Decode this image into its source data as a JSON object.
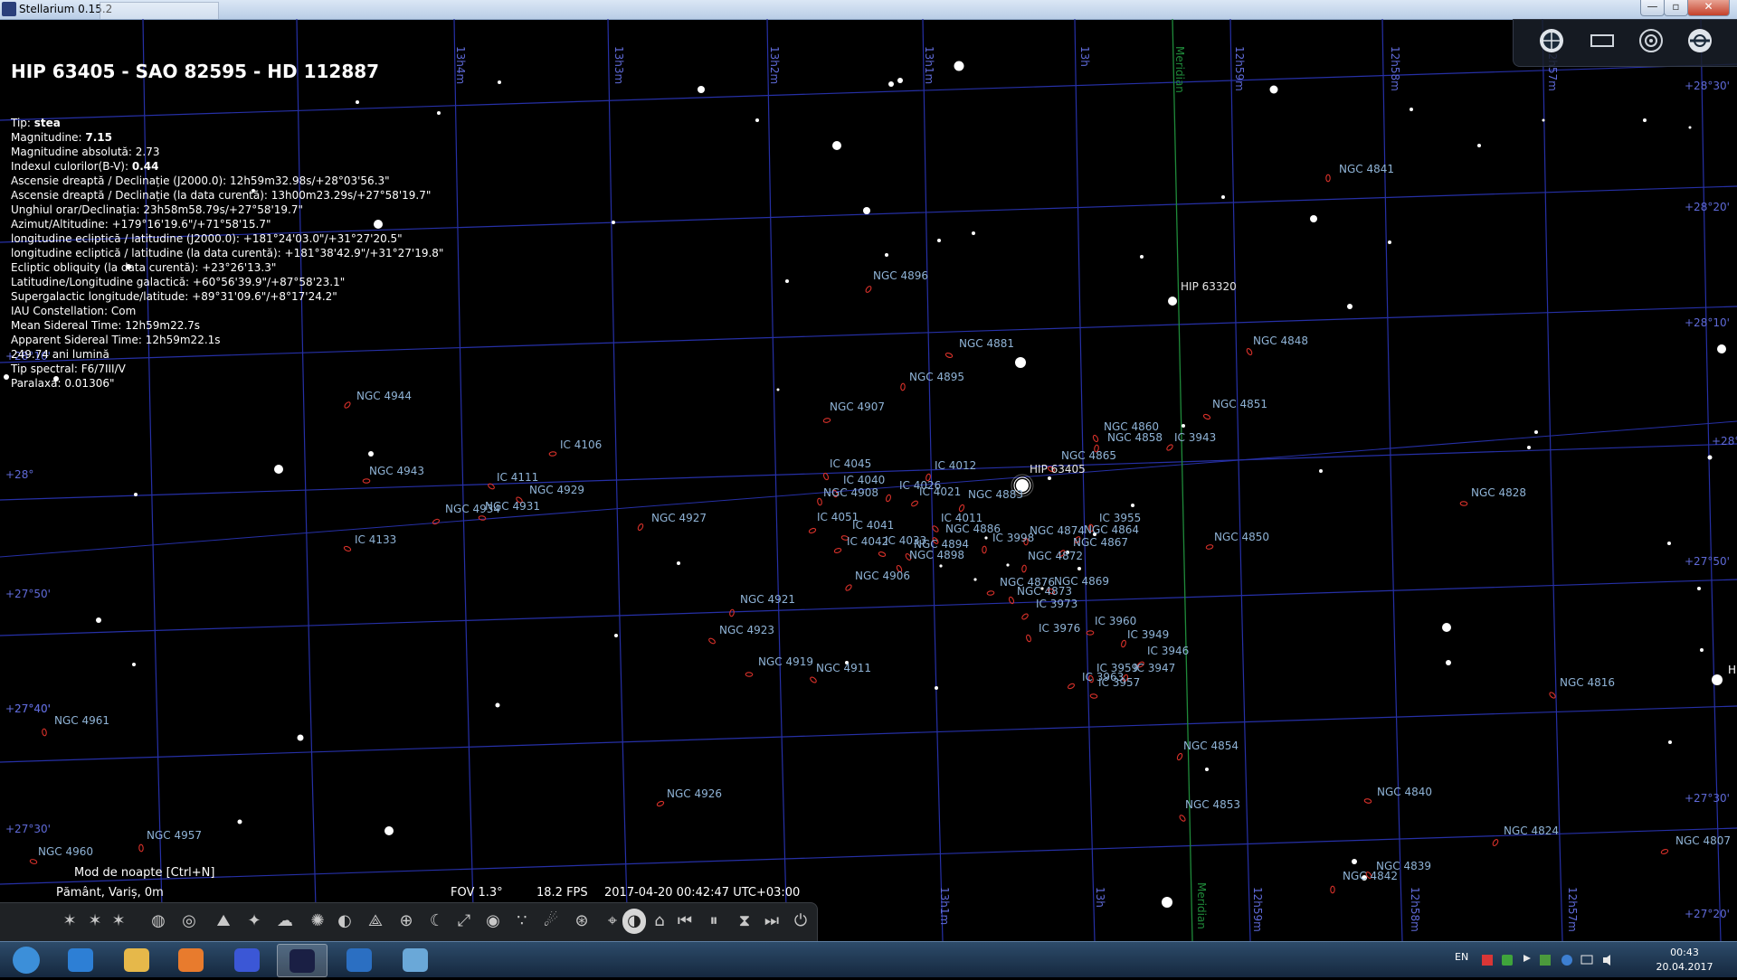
{
  "window": {
    "title": "Stellarium 0.15.2",
    "controls": [
      "minimize",
      "maximize",
      "close"
    ]
  },
  "info": {
    "object_title": "HIP 63405 - SAO 82595 - HD 112887",
    "lines": [
      {
        "label": "Tip:",
        "value": "stea",
        "bold": true
      },
      {
        "label": "Magnitudine:",
        "value": "7.15",
        "bold": true
      },
      {
        "label": "Magnitudine absolută:",
        "value": "2.73",
        "bold": false
      },
      {
        "label": "Indexul culorilor(B-V):",
        "value": "0.44",
        "bold": true
      },
      {
        "label": "Ascensie dreaptă / Declinație (J2000.0):",
        "value": "12h59m32.98s/+28°03'56.3\"",
        "bold": false
      },
      {
        "label": "Ascensie dreaptă / Declinație (la data curentă):",
        "value": "13h00m23.29s/+27°58'19.7\"",
        "bold": false
      },
      {
        "label": "Unghiul orar/Declinația:",
        "value": "23h58m58.79s/+27°58'19.7\"",
        "bold": false
      },
      {
        "label": "Azimut/Altitudine:",
        "value": "+179°16'19.6\"/+71°58'15.7\"",
        "bold": false
      },
      {
        "label": "longitudine ecliptică / latitudine (J2000.0):",
        "value": "+181°24'03.0\"/+31°27'20.5\"",
        "bold": false
      },
      {
        "label": "longitudine ecliptică / latitudine (la data curentă):",
        "value": "+181°38'42.9\"/+31°27'19.8\"",
        "bold": false
      },
      {
        "label": "Ecliptic obliquity (la data curentă):",
        "value": "+23°26'13.3\"",
        "bold": false
      },
      {
        "label": "Latitudine/Longitudine galactică:",
        "value": "+60°56'39.9\"/+87°58'23.1\"",
        "bold": false
      },
      {
        "label": "Supergalactic longitude/latitude:",
        "value": "+89°31'09.6\"/+8°17'24.2\"",
        "bold": false
      },
      {
        "label": "IAU Constellation:",
        "value": "Com",
        "bold": false
      },
      {
        "label": "Mean Sidereal Time:",
        "value": "12h59m22.7s",
        "bold": false
      },
      {
        "label": "Apparent Sidereal Time:",
        "value": "12h59m22.1s",
        "bold": false
      },
      {
        "label": "",
        "value": "249.74 ani lumină",
        "bold": false
      },
      {
        "label": "Tip spectral:",
        "value": "F6/7III/V",
        "bold": false
      },
      {
        "label": "Paralaxa:",
        "value": "0.01306\"",
        "bold": false
      }
    ]
  },
  "sky": {
    "dec_labels": [
      "+28°30'",
      "+28°20'",
      "+28°10'",
      "+28°",
      "+27°50'",
      "+27°40'",
      "+27°30'",
      "+27°20'"
    ],
    "ra_labels_top": [
      "13h4m",
      "13h3m",
      "13h2m",
      "13h1m",
      "13h",
      "12h59m",
      "12h58m",
      "12h57m"
    ],
    "ra_labels_bottom": [
      "13h1m",
      "13h",
      "12h59m",
      "12h58m",
      "12h57m"
    ],
    "meridian_label": "Meridian",
    "galaxy_labels": [
      "NGC 4841",
      "NGC 4896",
      "HIP 63320",
      "NGC 4881",
      "NGC 4848",
      "NGC 4895",
      "NGC 4944",
      "NGC 4907",
      "NGC 4851",
      "NGC 4860",
      "NGC 4858",
      "IC 3943",
      "IC 4106",
      "NGC 4865",
      "IC 4045",
      "IC 4012",
      "HIP 63405",
      "NGC 4943",
      "IC 4111",
      "IC 4040",
      "IC 4026",
      "IC 4021",
      "NGC 4828",
      "NGC 4929",
      "NGC 4908",
      "NGC 4883",
      "NGC 4934",
      "NGC 4931",
      "IC 4011",
      "IC 3955",
      "NGC 4927",
      "IC 4051",
      "IC 4041",
      "NGC 4886",
      "NGC 4874",
      "NGC 4864",
      "IC 4042",
      "IC 4033",
      "NGC 4894",
      "IC 3998",
      "NGC 4867",
      "NGC 4850",
      "IC 4133",
      "NGC 4898",
      "NGC 4872",
      "NGC 4906",
      "NGC 4876",
      "NGC 4869",
      "NGC 4873",
      "NGC 4921",
      "IC 3973",
      "IC 3960",
      "NGC 4923",
      "IC 3976",
      "IC 3949",
      "IC 3946",
      "NGC 4919",
      "NGC 4911",
      "IC 3959",
      "IC 3947",
      "IC 3963",
      "IC 3957",
      "NGC 4816",
      "NGC 4961",
      "NGC 4854",
      "NGC 4926",
      "NGC 4840",
      "NGC 4853",
      "NGC 4957",
      "NGC 4824",
      "NGC 4807",
      "NGC 4960",
      "NGC 4839",
      "NGC 4842"
    ],
    "edge_label": "HI"
  },
  "status": {
    "location": "Pământ, Variș, 0m",
    "fov": "FOV 1.3°",
    "fps": "18.2 FPS",
    "datetime": "2017-04-20 00:42:47 UTC+03:00",
    "night_mode_tooltip": "Mod de noapte  [Ctrl+N]"
  },
  "toolbar_icons": [
    "constellation-lines-icon",
    "constellation-labels-icon",
    "constellation-art-icon",
    "equatorial-grid-icon",
    "azimuthal-grid-icon",
    "ground-icon",
    "cardinal-points-icon",
    "atmosphere-icon",
    "nebulae-icon",
    "planets-icon",
    "equatorial-mount-icon",
    "center-object-icon",
    "night-mode-icon",
    "fullscreen-icon",
    "ocular-icon",
    "satellites-icon",
    "meteor-shower-icon",
    "exoplanets-icon",
    "telescope-icon",
    "observability-icon",
    "scenery-icon",
    "rewind-icon",
    "pause-icon",
    "set-time-now-icon",
    "forward-icon",
    "quit-icon"
  ],
  "top_right_icons": [
    "telescope-view-icon",
    "sensor-frame-icon",
    "ccd-target-icon",
    "ocular-config-icon"
  ],
  "taskbar": {
    "apps": [
      "start-orb-icon",
      "internet-explorer-icon",
      "file-explorer-icon",
      "media-player-icon",
      "blue-gem-app-icon",
      "stellarium-icon",
      "remote-app-icon",
      "paint-icon"
    ],
    "tray_language": "EN",
    "clock_time": "00:43",
    "clock_date": "20.04.2017"
  },
  "colors": {
    "grid": "#2630a6",
    "meridian": "#1f8a3a",
    "galaxy_label": "#8fb3d6",
    "galaxy_marker": "#d8312a",
    "text": "#ffffff"
  }
}
